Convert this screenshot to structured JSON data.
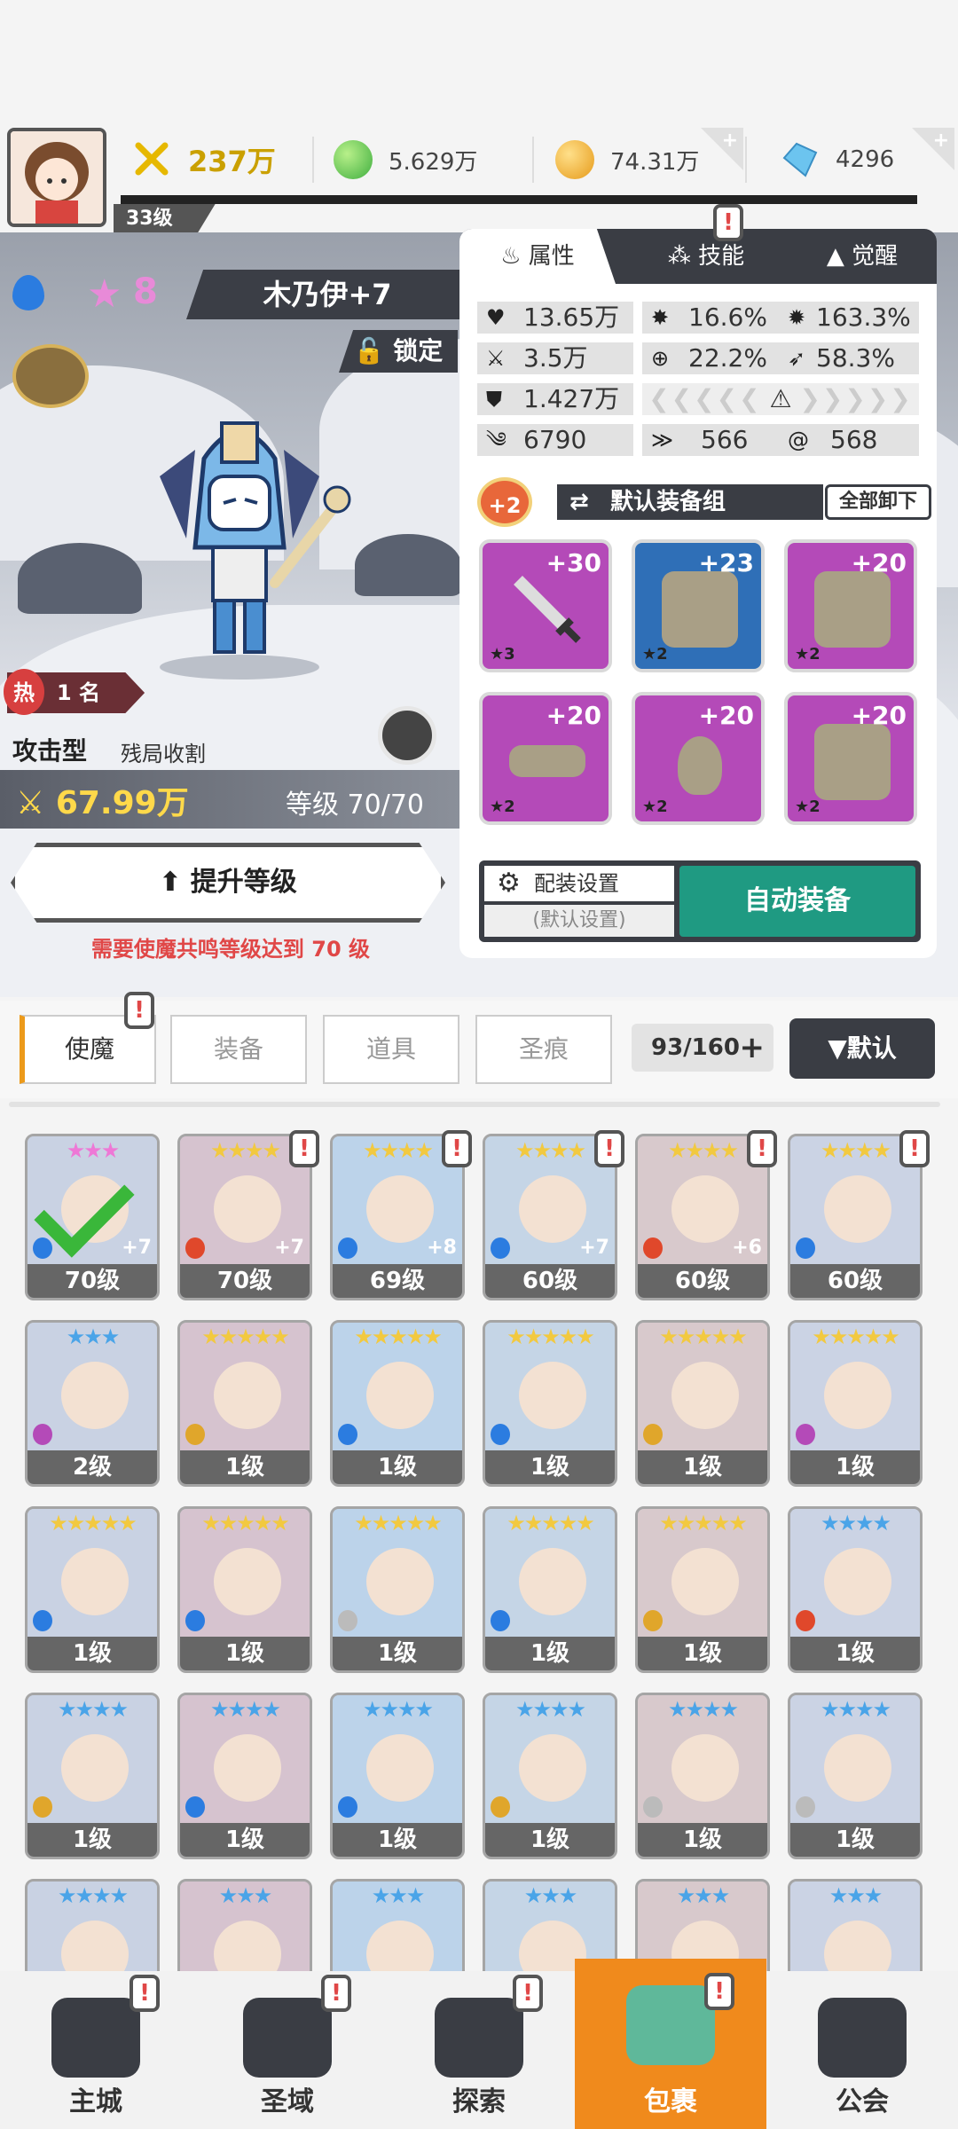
{
  "player": {
    "level": "33级"
  },
  "resources": {
    "power": "237万",
    "green": "5.629万",
    "gold": "74.31万",
    "gem": "4296"
  },
  "hero": {
    "stars": "8",
    "name": "木乃伊+7",
    "lock_label": "锁定",
    "rank": "1 名",
    "rank_icon": "热",
    "type": "攻击型",
    "trait": "残局收割",
    "power": "67.99万",
    "level": "等级 70/70",
    "upgrade_label": "提升等级",
    "warning": "需要使魔共鸣等级达到 70 级"
  },
  "panel": {
    "tabs": [
      "属性",
      "技能",
      "觉醒"
    ],
    "stats": {
      "hp": "13.65万",
      "crit": "16.6%",
      "crit_dmg": "163.3%",
      "atk": "3.5万",
      "hit": "22.2%",
      "speed": "58.3%",
      "def": "1.427万",
      "s1": "6790",
      "s2": "566",
      "s3": "568"
    },
    "equip_bonus": "+2",
    "equip_set": "默认装备组",
    "unequip_all": "全部卸下",
    "slots": [
      {
        "plus": "+30",
        "stars": "★3",
        "color": "purple"
      },
      {
        "plus": "+23",
        "stars": "★2",
        "color": "blue"
      },
      {
        "plus": "+20",
        "stars": "★2",
        "color": "purple"
      },
      {
        "plus": "+20",
        "stars": "★2",
        "color": "purple"
      },
      {
        "plus": "+20",
        "stars": "★2",
        "color": "purple"
      },
      {
        "plus": "+20",
        "stars": "★2",
        "color": "purple"
      }
    ],
    "config_label": "配装设置",
    "config_sub": "(默认设置)",
    "auto_equip": "自动装备"
  },
  "inventory": {
    "tabs": [
      "使魔",
      "装备",
      "道具",
      "圣痕"
    ],
    "count": "93/160",
    "sort": "▼默认"
  },
  "heroes": [
    {
      "level": "70级",
      "stars": "★★★",
      "star_color": "pink",
      "plus": "+7",
      "element": "water",
      "selected": true,
      "alert": false
    },
    {
      "level": "70级",
      "stars": "★★★★",
      "star_color": "gold",
      "plus": "+7",
      "element": "fire",
      "alert": true
    },
    {
      "level": "69级",
      "stars": "★★★★",
      "star_color": "gold",
      "plus": "+8",
      "element": "water",
      "alert": true
    },
    {
      "level": "60级",
      "stars": "★★★★",
      "star_color": "gold",
      "plus": "+7",
      "element": "water",
      "alert": true
    },
    {
      "level": "60级",
      "stars": "★★★★",
      "star_color": "gold",
      "plus": "+6",
      "element": "fire",
      "alert": true
    },
    {
      "level": "60级",
      "stars": "★★★★",
      "star_color": "gold",
      "plus": "",
      "element": "water",
      "alert": true
    },
    {
      "level": "2级",
      "stars": "★★★",
      "star_color": "blue",
      "plus": "",
      "element": "dark"
    },
    {
      "level": "1级",
      "stars": "★★★★★",
      "star_color": "gold",
      "plus": "",
      "element": "wind"
    },
    {
      "level": "1级",
      "stars": "★★★★★",
      "star_color": "gold",
      "plus": "",
      "element": "water"
    },
    {
      "level": "1级",
      "stars": "★★★★★",
      "star_color": "gold",
      "plus": "",
      "element": "water"
    },
    {
      "level": "1级",
      "stars": "★★★★★",
      "star_color": "gold",
      "plus": "",
      "element": "wind"
    },
    {
      "level": "1级",
      "stars": "★★★★★",
      "star_color": "gold",
      "plus": "",
      "element": "dark"
    },
    {
      "level": "1级",
      "stars": "★★★★★",
      "star_color": "gold",
      "plus": "",
      "element": "water"
    },
    {
      "level": "1级",
      "stars": "★★★★★",
      "star_color": "gold",
      "plus": "",
      "element": "water"
    },
    {
      "level": "1级",
      "stars": "★★★★★",
      "star_color": "gold",
      "plus": "",
      "element": "light"
    },
    {
      "level": "1级",
      "stars": "★★★★★",
      "star_color": "gold",
      "plus": "",
      "element": "water"
    },
    {
      "level": "1级",
      "stars": "★★★★★",
      "star_color": "gold",
      "plus": "",
      "element": "wind"
    },
    {
      "level": "1级",
      "stars": "★★★★",
      "star_color": "blue",
      "plus": "",
      "element": "fire"
    },
    {
      "level": "1级",
      "stars": "★★★★",
      "star_color": "blue",
      "plus": "",
      "element": "wind"
    },
    {
      "level": "1级",
      "stars": "★★★★",
      "star_color": "blue",
      "plus": "",
      "element": "water"
    },
    {
      "level": "1级",
      "stars": "★★★★",
      "star_color": "blue",
      "plus": "",
      "element": "water"
    },
    {
      "level": "1级",
      "stars": "★★★★",
      "star_color": "blue",
      "plus": "",
      "element": "wind"
    },
    {
      "level": "1级",
      "stars": "★★★★",
      "star_color": "blue",
      "plus": "",
      "element": "light"
    },
    {
      "level": "1级",
      "stars": "★★★★",
      "star_color": "blue",
      "plus": "",
      "element": "light"
    },
    {
      "level": "",
      "stars": "★★★★",
      "star_color": "blue",
      "plus": "",
      "element": ""
    },
    {
      "level": "",
      "stars": "★★★",
      "star_color": "blue",
      "plus": "",
      "element": ""
    },
    {
      "level": "",
      "stars": "★★★",
      "star_color": "blue",
      "plus": "",
      "element": ""
    },
    {
      "level": "",
      "stars": "★★★",
      "star_color": "blue",
      "plus": "",
      "element": ""
    },
    {
      "level": "",
      "stars": "★★★",
      "star_color": "blue",
      "plus": "",
      "element": ""
    },
    {
      "level": "",
      "stars": "★★★",
      "star_color": "blue",
      "plus": "",
      "element": ""
    }
  ],
  "nav": [
    {
      "label": "主城",
      "icon": "castle-icon",
      "alert": true
    },
    {
      "label": "圣域",
      "icon": "portal-icon",
      "alert": true
    },
    {
      "label": "探索",
      "icon": "sword-icon",
      "alert": true
    },
    {
      "label": "包裹",
      "icon": "bag-icon",
      "alert": true,
      "active": true
    },
    {
      "label": "公会",
      "icon": "guild-icon",
      "alert": false
    }
  ],
  "colors": {
    "accent": "#f08a1c",
    "auto_equip": "#1f9a82",
    "warning": "#e04747",
    "gold": "#ffd94a"
  }
}
